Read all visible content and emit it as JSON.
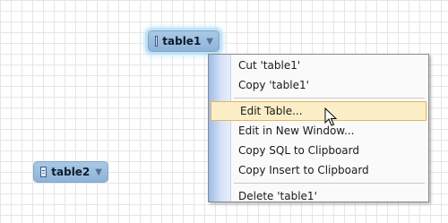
{
  "nodes": {
    "table1": {
      "label": "table1"
    },
    "table2": {
      "label": "table2"
    }
  },
  "context_menu": {
    "items": [
      {
        "label": "Cut 'table1'"
      },
      {
        "label": "Copy 'table1'"
      },
      {
        "label": "Edit Table..."
      },
      {
        "label": "Edit in New Window..."
      },
      {
        "label": "Copy SQL to Clipboard"
      },
      {
        "label": "Copy Insert to Clipboard"
      },
      {
        "label": "Delete 'table1'"
      }
    ],
    "highlighted_item": "Edit Table..."
  },
  "icons": {
    "table": "table-icon",
    "dropdown": "triangle-down",
    "cursor": "mouse-pointer-icon"
  },
  "colors": {
    "node_fill": "#8fb4d8",
    "selection_glow": "#bfe2f6",
    "menu_highlight": "#fbeec7",
    "menu_highlight_border": "#e6b65a"
  }
}
